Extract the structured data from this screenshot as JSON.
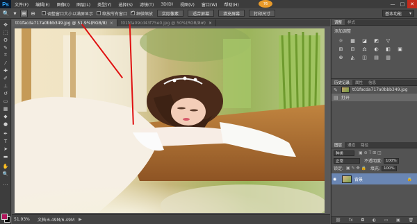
{
  "app": {
    "logo": "Ps"
  },
  "menu": [
    "文件(F)",
    "编辑(E)",
    "图像(I)",
    "图层(L)",
    "类型(Y)",
    "选择(S)",
    "滤镜(T)",
    "3D(D)",
    "视图(V)",
    "窗口(W)",
    "帮助(H)"
  ],
  "window_controls": {
    "minimize": "—",
    "maximize": "□",
    "close": "✕"
  },
  "options": {
    "resize_windows": "调整窗口大小以满屏显示",
    "zoom_all_windows": "缩放所有窗口",
    "scrubby_zoom": "细微缩放",
    "actual_pixels": "实际像素",
    "fit_screen": "适合屏幕",
    "fill_screen": "填充屏幕",
    "print_size": "打印尺寸",
    "resize_checked": false,
    "zoom_all_checked": false,
    "scrubby_checked": true
  },
  "workspace": {
    "label": "基本功能"
  },
  "tabs": [
    {
      "label": "t01facda717a0bbb349.jpg @ 51.9%(RGB/8)",
      "close": "×"
    },
    {
      "label": "t01fda09cd43f75e0.jpg @ 50%(RGB/8#)",
      "close": "×"
    }
  ],
  "status": {
    "zoom": "51.93%",
    "doc": "文档:6.49M/6.49M",
    "arrow": "▶"
  },
  "adjustments": {
    "tabs": [
      "调整",
      "样式"
    ],
    "title": "添加调整",
    "icons": [
      "☼",
      "▦",
      "◪",
      "◩",
      "▽",
      "⊞",
      "⊟",
      "⚖",
      "◐",
      "◧",
      "▣",
      "⊕",
      "◭",
      "◫",
      "▤",
      "▥"
    ]
  },
  "history": {
    "tabs": [
      "历史记录",
      "属性",
      "信息"
    ],
    "snapshot": "t01facda717a0bbb349.jpg",
    "step": "打开"
  },
  "layers": {
    "tabs": [
      "图层",
      "通道",
      "路径"
    ],
    "kind": "种类",
    "blend": "正常",
    "opacity_label": "不透明度:",
    "opacity": "100%",
    "lock_label": "锁定:",
    "fill_label": "填充:",
    "fill": "100%",
    "layer_name": "背景"
  },
  "tips_badge": "76"
}
